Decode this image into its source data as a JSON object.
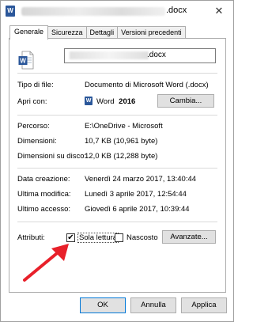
{
  "titlebar": {
    "title_suffix": ".docx",
    "close_icon": "✕"
  },
  "tabs": [
    "Generale",
    "Sicurezza",
    "Dettagli",
    "Versioni precedenti"
  ],
  "general": {
    "file_name_suffix": ".docx",
    "file_type_label": "Tipo di file:",
    "file_type_value": "Documento di Microsoft Word (.docx)",
    "opens_with_label": "Apri con:",
    "opens_with_app": "Word",
    "opens_with_version": "2016",
    "change_button": "Cambia...",
    "location_label": "Percorso:",
    "location_value": "E:\\OneDrive - Microsoft",
    "size_label": "Dimensioni:",
    "size_value": "10,7 KB (10,961 byte)",
    "size_on_disk_label": "Dimensioni su disco:",
    "size_on_disk_value": "12,0 KB (12,288 byte)",
    "created_label": "Data creazione:",
    "created_value": "Venerdì 24 marzo 2017, 13:40:44",
    "modified_label": "Ultima modifica:",
    "modified_value": "Lunedì 3 aprile 2017, 12:54:44",
    "accessed_label": "Ultimo accesso:",
    "accessed_value": "Giovedì 6 aprile 2017, 10:39:44",
    "attributes_label": "Attributi:",
    "readonly_label": "Sola lettura",
    "readonly_checked": true,
    "hidden_label": "Nascosto",
    "hidden_checked": false,
    "advanced_button": "Avanzate..."
  },
  "footer": {
    "ok": "OK",
    "cancel": "Annulla",
    "apply": "Applica"
  },
  "icons": {
    "word_letter": "W",
    "check": "✔"
  },
  "colors": {
    "word_blue": "#2b579a",
    "arrow_red": "#e8202a",
    "focus_blue": "#0078d7"
  }
}
